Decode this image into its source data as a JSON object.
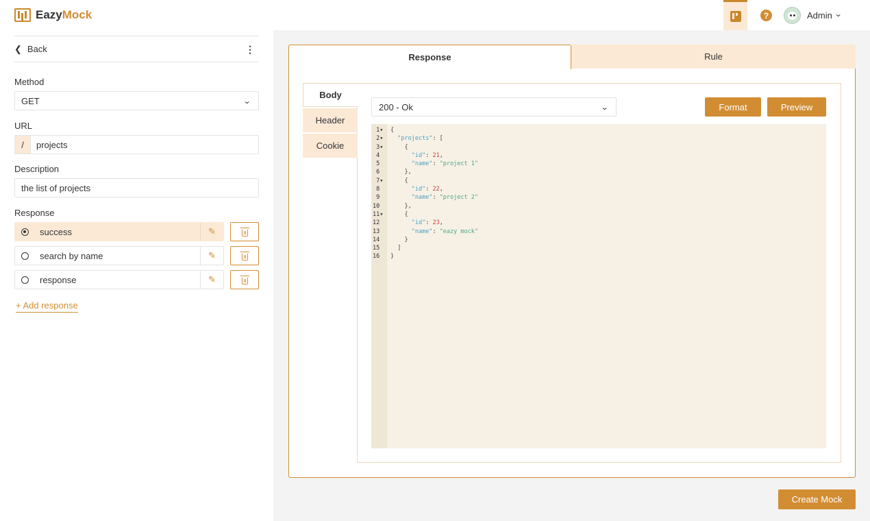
{
  "app": {
    "name_part1": "Eazy",
    "name_part2": "Mock"
  },
  "topbar": {
    "help_symbol": "?",
    "user_name": "Admin"
  },
  "sidebar": {
    "back_label": "Back",
    "method": {
      "label": "Method",
      "value": "GET"
    },
    "url": {
      "label": "URL",
      "prefix": "/",
      "value": "projects"
    },
    "description": {
      "label": "Description",
      "value": "the list of projects"
    },
    "responses": {
      "label": "Response",
      "items": [
        {
          "name": "success",
          "selected": true
        },
        {
          "name": "search by name",
          "selected": false
        },
        {
          "name": "response",
          "selected": false
        }
      ],
      "add_label": "+ Add response"
    }
  },
  "main": {
    "tabs": [
      {
        "label": "Response"
      },
      {
        "label": "Rule"
      }
    ],
    "subtabs": [
      {
        "label": "Body"
      },
      {
        "label": "Header"
      },
      {
        "label": "Cookie"
      }
    ],
    "status_select": "200 - Ok",
    "format_label": "Format",
    "preview_label": "Preview",
    "editor": {
      "line_numbers": [
        "1",
        "2",
        "3",
        "4",
        "5",
        "6",
        "7",
        "8",
        "9",
        "10",
        "11",
        "12",
        "13",
        "14",
        "15",
        "16"
      ],
      "fold_lines": [
        1,
        2,
        3,
        7,
        11
      ],
      "lines": [
        [
          [
            "p",
            "{"
          ]
        ],
        [
          [
            "p",
            "  "
          ],
          [
            "k",
            "\"projects\""
          ],
          [
            "p",
            ": ["
          ]
        ],
        [
          [
            "p",
            "    {"
          ]
        ],
        [
          [
            "p",
            "      "
          ],
          [
            "k",
            "\"id\""
          ],
          [
            "p",
            ": "
          ],
          [
            "n",
            "21"
          ],
          [
            "p",
            ","
          ]
        ],
        [
          [
            "p",
            "      "
          ],
          [
            "k",
            "\"name\""
          ],
          [
            "p",
            ": "
          ],
          [
            "s",
            "\"project 1\""
          ]
        ],
        [
          [
            "p",
            "    },"
          ]
        ],
        [
          [
            "p",
            "    {"
          ]
        ],
        [
          [
            "p",
            "      "
          ],
          [
            "k",
            "\"id\""
          ],
          [
            "p",
            ": "
          ],
          [
            "n",
            "22"
          ],
          [
            "p",
            ","
          ]
        ],
        [
          [
            "p",
            "      "
          ],
          [
            "k",
            "\"name\""
          ],
          [
            "p",
            ": "
          ],
          [
            "s",
            "\"project 2\""
          ]
        ],
        [
          [
            "p",
            "    },"
          ]
        ],
        [
          [
            "p",
            "    {"
          ]
        ],
        [
          [
            "p",
            "      "
          ],
          [
            "k",
            "\"id\""
          ],
          [
            "p",
            ": "
          ],
          [
            "n",
            "23"
          ],
          [
            "p",
            ","
          ]
        ],
        [
          [
            "p",
            "      "
          ],
          [
            "k",
            "\"name\""
          ],
          [
            "p",
            ": "
          ],
          [
            "s",
            "\"eazy mock\""
          ]
        ],
        [
          [
            "p",
            "    }"
          ]
        ],
        [
          [
            "p",
            "  ]"
          ]
        ],
        [
          [
            "p",
            "}"
          ]
        ]
      ]
    },
    "create_label": "Create Mock"
  },
  "colors": {
    "accent": "#d28d33",
    "accent_light": "#fbe9d6",
    "editor_bg": "#f7f1e5"
  }
}
